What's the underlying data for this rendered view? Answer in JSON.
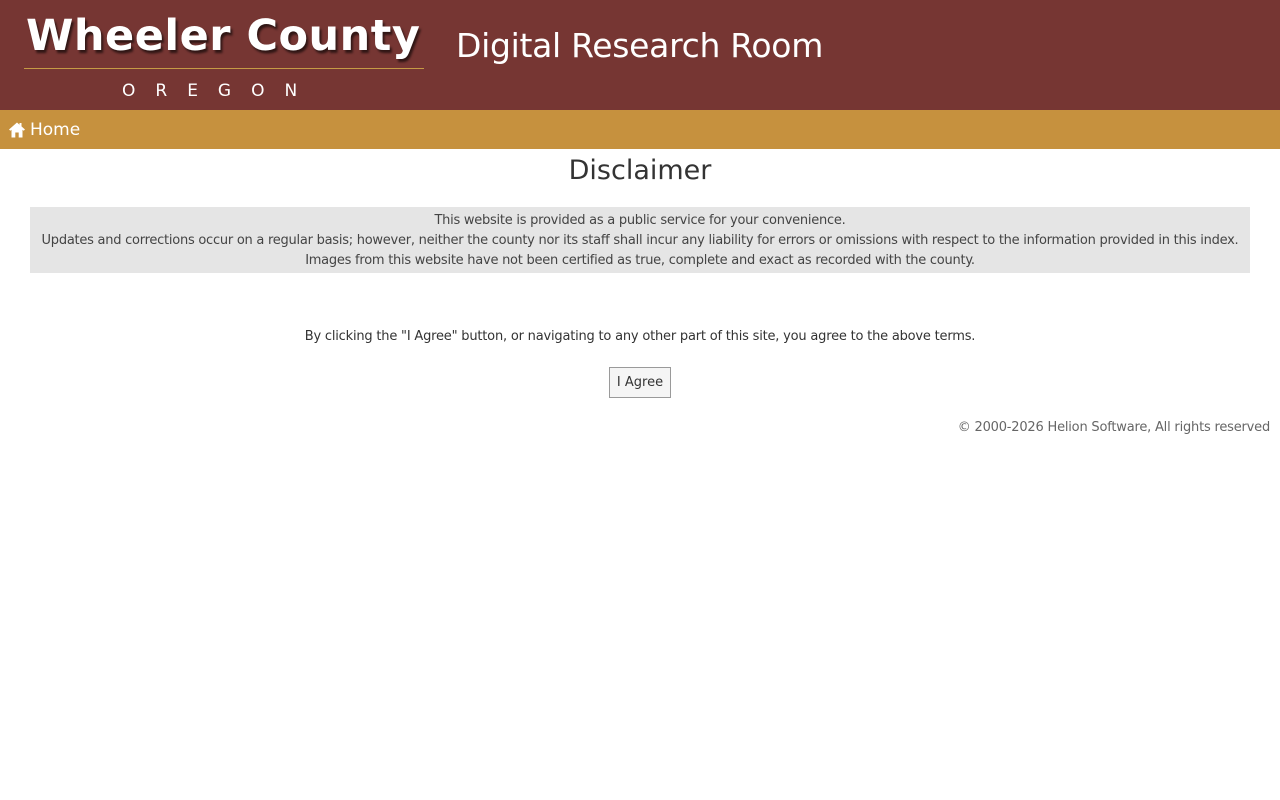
{
  "header": {
    "logo_name": "Wheeler County",
    "logo_state": "OREGON",
    "site_title": "Digital Research Room"
  },
  "nav": {
    "home_label": "Home",
    "home_icon": "home-icon"
  },
  "main": {
    "title": "Disclaimer",
    "disclaimer_lines": [
      "This website is provided as a public service for your convenience.",
      "Updates and corrections occur on a regular basis; however, neither the county nor its staff shall incur any liability for errors or omissions with respect to the information provided in this index.",
      "Images from this website have not been certified as true, complete and exact as recorded with the county."
    ],
    "agree_notice": "By clicking the \"I Agree\" button, or navigating to any other part of this site, you agree to the above terms.",
    "agree_button_label": "I Agree"
  },
  "footer": {
    "copyright": "© 2000-2026 Helion Software, All rights reserved"
  },
  "colors": {
    "header_background": "#763633",
    "nav_background": "#c6913e",
    "disclaimer_background": "#e5e5e5",
    "logo_rule": "#c59a45"
  }
}
